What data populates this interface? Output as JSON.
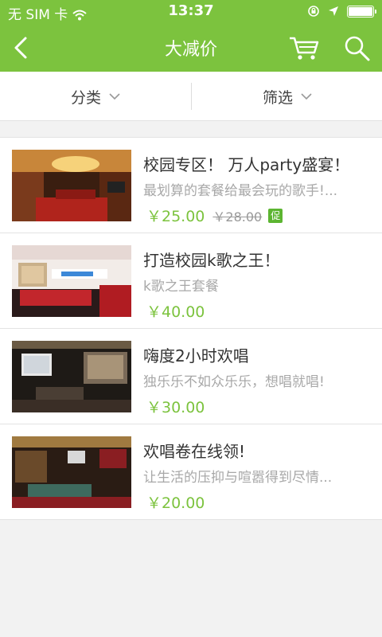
{
  "status_bar": {
    "carrier": "无 SIM 卡",
    "time": "13:37"
  },
  "navbar": {
    "title": "大减价"
  },
  "filters": {
    "category_label": "分类",
    "filter_label": "筛选"
  },
  "items": [
    {
      "title": "校园专区！ 万人party盛宴！",
      "desc": "最划算的套餐给最会玩的歌手!...",
      "price": "￥25.00",
      "old_price": "￥28.00",
      "badge": "促"
    },
    {
      "title": "打造校园k歌之王！",
      "desc": "k歌之王套餐",
      "price": "￥40.00"
    },
    {
      "title": "嗨度2小时欢唱",
      "desc": "独乐乐不如众乐乐，想唱就唱!",
      "price": "￥30.00"
    },
    {
      "title": "欢唱卷在线领!",
      "desc": "让生活的压抑与喧嚣得到尽情...",
      "price": "￥20.00"
    }
  ],
  "colors": {
    "brand": "#7cc33e",
    "badge": "#5cb531"
  }
}
